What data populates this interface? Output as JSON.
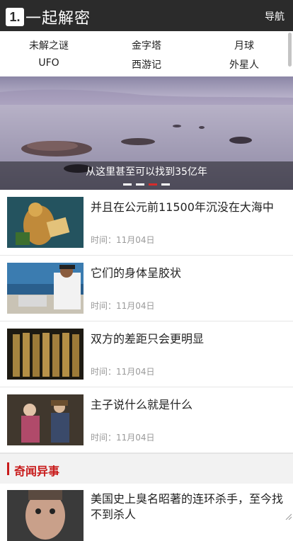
{
  "header": {
    "logo_mark": "1.",
    "title": "一起解密",
    "nav_label": "导航"
  },
  "categories": [
    "未解之谜",
    "金字塔",
    "月球",
    "UFO",
    "西游记",
    "外星人"
  ],
  "banner": {
    "caption": "从这里甚至可以找到35亿年",
    "slide_count": 4,
    "active_index": 2
  },
  "articles": [
    {
      "title": "并且在公元前11500年沉没在大海中",
      "time": "时间：11月04日"
    },
    {
      "title": "它们的身体呈胶状",
      "time": "时间：11月04日"
    },
    {
      "title": "双方的差距只会更明显",
      "time": "时间：11月04日"
    },
    {
      "title": "主子说什么就是什么",
      "time": "时间：11月04日"
    }
  ],
  "section": {
    "title": "奇闻异事"
  },
  "section_articles": [
    {
      "title": "美国史上臭名昭著的连环杀手，至今找不到杀人"
    }
  ],
  "colors": {
    "header_bg": "#2b2b2b",
    "accent": "#c81b1b"
  }
}
